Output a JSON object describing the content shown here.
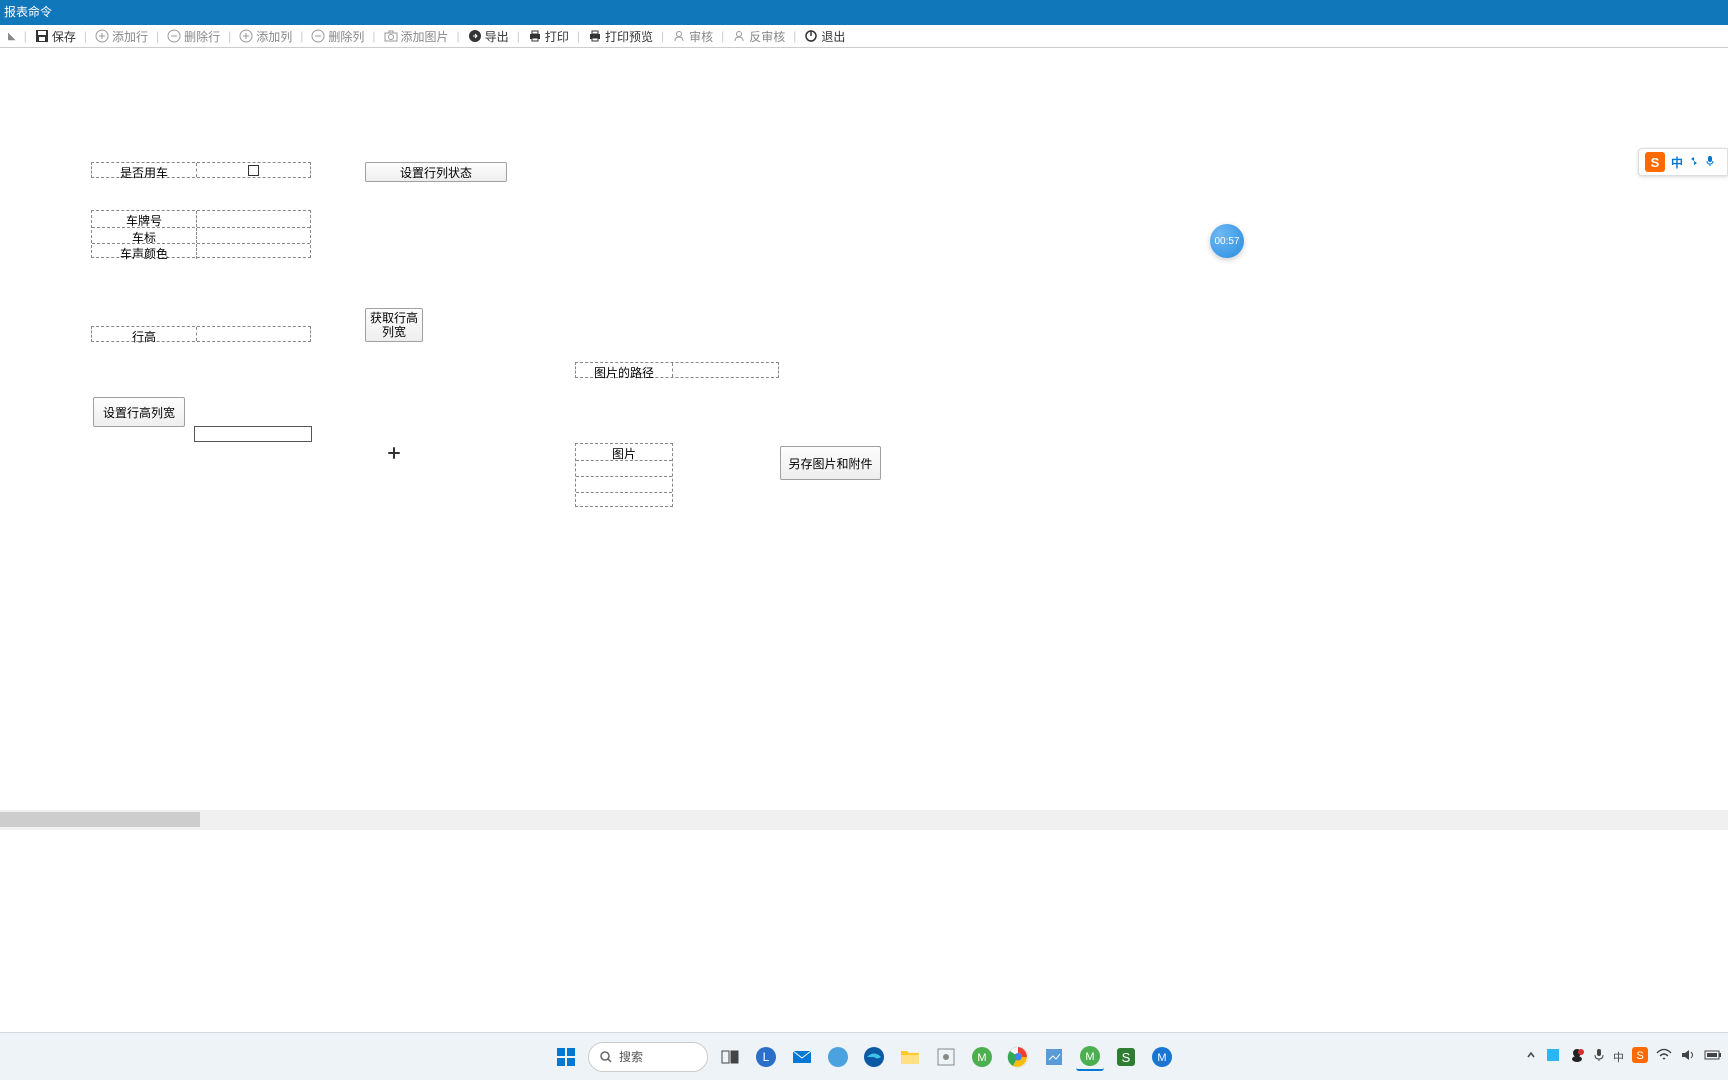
{
  "title": "报表命令",
  "toolbar": {
    "save": "保存",
    "addRow": "添加行",
    "delRow": "删除行",
    "addCol": "添加列",
    "delCol": "删除列",
    "addImg": "添加图片",
    "export": "导出",
    "print": "打印",
    "preview": "打印预览",
    "audit": "审核",
    "unaudit": "反审核",
    "exit": "退出"
  },
  "fields": {
    "useCar": "是否用车",
    "plate": "车牌号",
    "brand": "车标",
    "color": "车声颜色",
    "rowHeight": "行高",
    "imgPath": "图片的路径",
    "image": "图片"
  },
  "buttons": {
    "setRowColState": "设置行列状态",
    "getRowColSize": "获取行高\n列宽",
    "setRowColSize": "设置行高列宽",
    "saveImgAttach": "另存图片和附件"
  },
  "timer": "00:57",
  "ime": {
    "lang": "中"
  },
  "taskbar": {
    "search": "搜索"
  }
}
